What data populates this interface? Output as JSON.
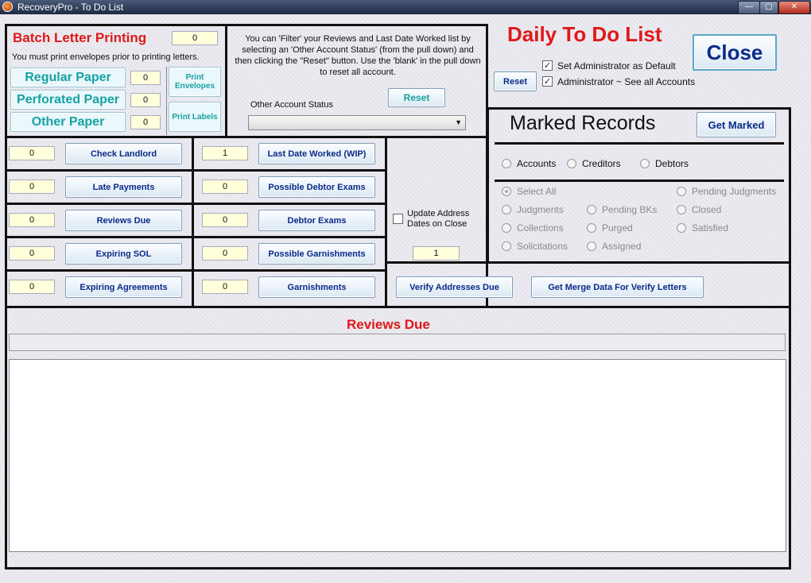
{
  "window": {
    "title": "RecoveryPro - To Do List",
    "controls": [
      "—",
      "▢",
      "✕"
    ]
  },
  "batch": {
    "title": "Batch Letter Printing",
    "count": "0",
    "note": "You must print envelopes prior to printing letters.",
    "papers": [
      {
        "label": "Regular Paper",
        "count": "0"
      },
      {
        "label": "Perforated Paper",
        "count": "0"
      },
      {
        "label": "Other Paper",
        "count": "0"
      }
    ],
    "print_envelopes": "Print Envelopes",
    "print_labels": "Print Labels"
  },
  "filter": {
    "help_text": "You can 'Filter' your Reviews and Last Date Worked list by selecting an 'Other Account Status' (from the pull down) and then clicking the \"Reset\" button. Use the 'blank' in the pull down to reset all account.",
    "reset_label": "Reset",
    "status_label": "Other Account Status",
    "status_value": ""
  },
  "header": {
    "title": "Daily To Do List",
    "close_label": "Close",
    "reset_label": "Reset",
    "admin_default": {
      "label": "Set Administrator as Default",
      "checked": true
    },
    "admin_all": {
      "label": "Administrator ~ See all Accounts",
      "checked": true
    }
  },
  "marked": {
    "title": "Marked Records",
    "get_marked": "Get Marked",
    "types": [
      "Accounts",
      "Creditors",
      "Debtors"
    ],
    "filters": {
      "col1": [
        "Select All",
        "Judgments",
        "Collections",
        "Solicitations"
      ],
      "col2": [
        "Pending BKs",
        "Purged",
        "Assigned"
      ],
      "col3": [
        "Pending Judgments",
        "Closed",
        "Satisfied"
      ]
    }
  },
  "tasks_left": [
    {
      "count": "0",
      "label": "Check Landlord"
    },
    {
      "count": "0",
      "label": "Late Payments"
    },
    {
      "count": "0",
      "label": "Reviews Due"
    },
    {
      "count": "0",
      "label": "Expiring SOL"
    },
    {
      "count": "0",
      "label": "Expiring Agreements"
    }
  ],
  "tasks_mid": [
    {
      "count": "1",
      "label": "Last Date Worked (WIP)"
    },
    {
      "count": "0",
      "label": "Possible Debtor Exams"
    },
    {
      "count": "0",
      "label": "Debtor Exams"
    },
    {
      "count": "0",
      "label": "Possible Garnishments"
    },
    {
      "count": "0",
      "label": "Garnishments"
    }
  ],
  "address": {
    "update_label": "Update Address Dates on Close",
    "days": "1",
    "verify_label": "Verify Addresses Due",
    "merge_label": "Get Merge Data For Verify Letters"
  },
  "reviews": {
    "title": "Reviews Due",
    "filter_value": "",
    "list": []
  }
}
